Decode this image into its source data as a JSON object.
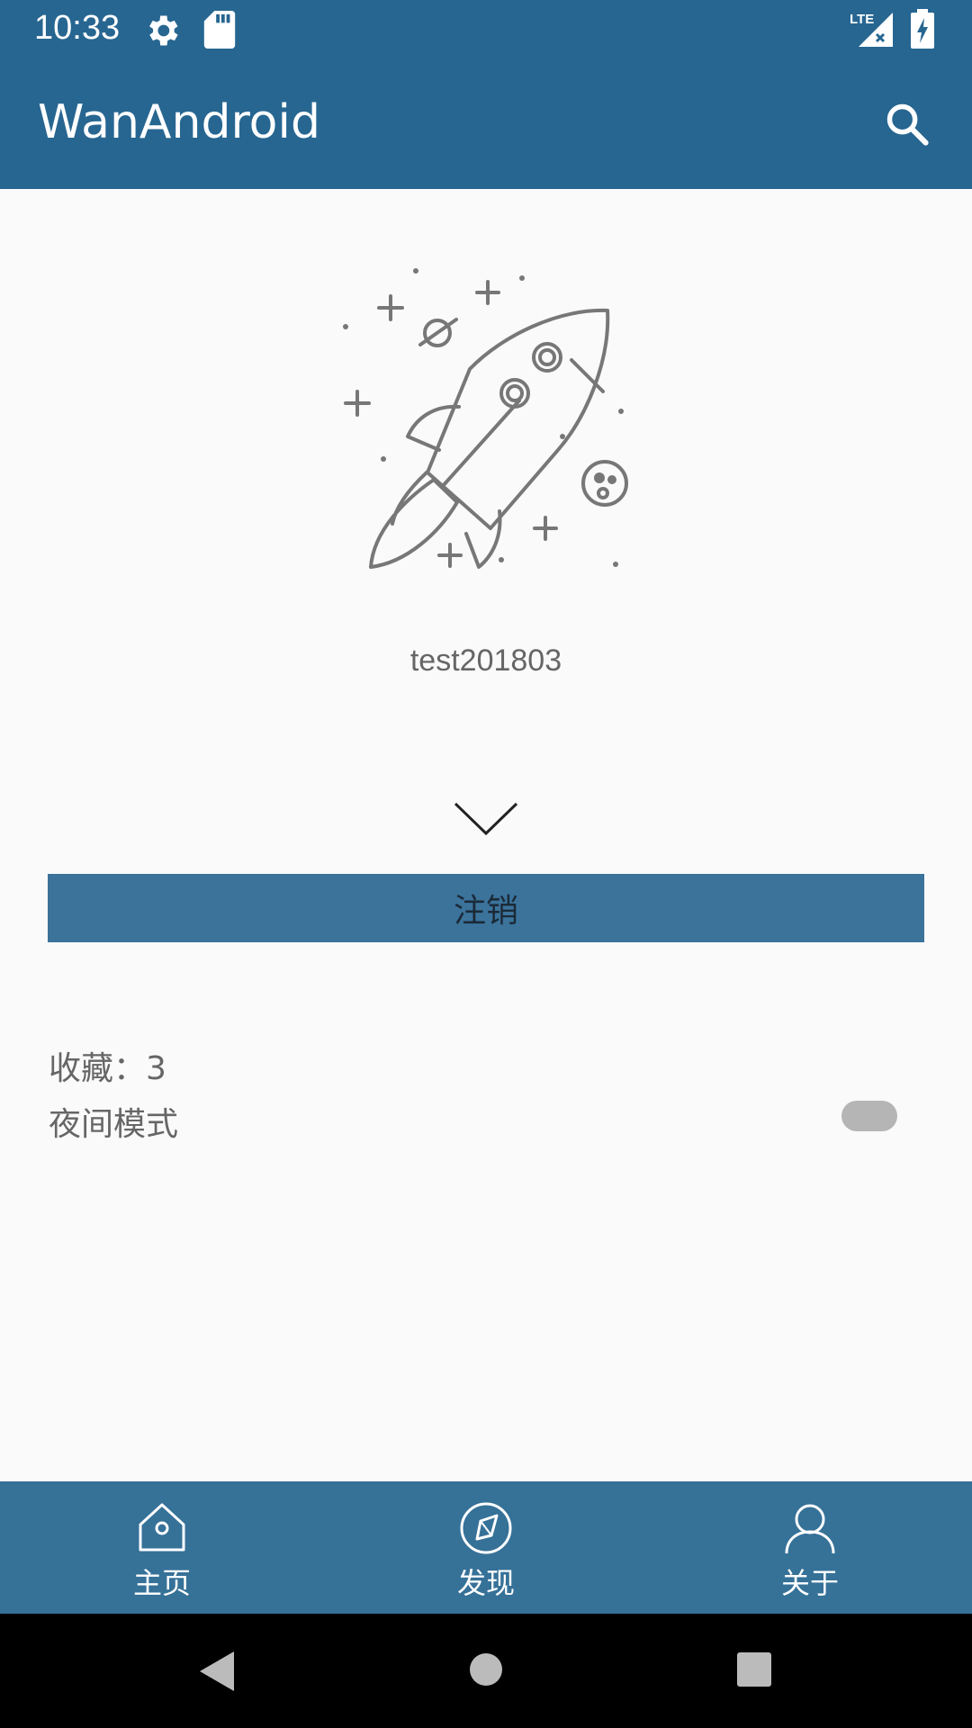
{
  "status_bar": {
    "time": "10:33",
    "network": "LTE",
    "icons": [
      "gear-icon",
      "sd-card-icon",
      "signal-icon",
      "battery-charging-icon"
    ]
  },
  "toolbar": {
    "title": "WanAndroid",
    "search_icon": "search-icon"
  },
  "profile": {
    "username": "test201803",
    "illustration": "rocket-illustration",
    "expand_icon": "chevron-down-icon"
  },
  "logout_label": "注销",
  "stats": {
    "favorites_label": "收藏：3",
    "night_mode_label": "夜间模式",
    "night_mode_on": false
  },
  "bottom_nav": {
    "items": [
      {
        "label": "主页",
        "icon": "home-icon"
      },
      {
        "label": "发现",
        "icon": "compass-icon"
      },
      {
        "label": "关于",
        "icon": "person-icon"
      }
    ]
  },
  "system_nav": [
    "back-icon",
    "home-circle-icon",
    "recents-icon"
  ],
  "colors": {
    "primary": "#276691",
    "logout_button": "#3b739b",
    "bottom_nav": "#367198",
    "background": "#fafafa"
  }
}
